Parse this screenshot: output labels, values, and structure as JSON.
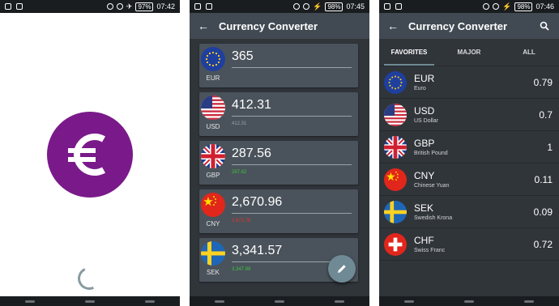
{
  "status": {
    "s1": {
      "battery": "97",
      "time": "07:42"
    },
    "s2": {
      "battery": "98",
      "time": "07:45"
    },
    "s3": {
      "battery": "98",
      "time": "07:46"
    }
  },
  "app": {
    "title": "Currency Converter",
    "back_icon": "back-arrow-icon",
    "search_icon": "search-icon"
  },
  "splash": {
    "logo_icon": "euro-icon",
    "logo_color": "#7a1a8a"
  },
  "converter": {
    "cards": [
      {
        "code": "EUR",
        "amount": "365",
        "sub": "",
        "sub_color": "#9aa2a8"
      },
      {
        "code": "USD",
        "amount": "412.31",
        "sub": "412.31",
        "sub_color": "#9aa2a8"
      },
      {
        "code": "GBP",
        "amount": "287.56",
        "sub": "287.62",
        "sub_color": "#3ec43e"
      },
      {
        "code": "CNY",
        "amount": "2,670.96",
        "sub": "2,672.79",
        "sub_color": "#e0352b"
      },
      {
        "code": "SEK",
        "amount": "3,341.57",
        "sub": "3,347.99",
        "sub_color": "#3ec43e"
      }
    ],
    "fab_icon": "pencil-icon"
  },
  "rates": {
    "tabs": [
      "FAVORITES",
      "MAJOR",
      "ALL"
    ],
    "active_tab": "FAVORITES",
    "rows": [
      {
        "code": "EUR",
        "name": "Euro",
        "rate": "0.79"
      },
      {
        "code": "USD",
        "name": "US Dollar",
        "rate": "0.7"
      },
      {
        "code": "GBP",
        "name": "British Pound",
        "rate": "1"
      },
      {
        "code": "CNY",
        "name": "Chinese Yuan",
        "rate": "0.11"
      },
      {
        "code": "SEK",
        "name": "Swedish Krona",
        "rate": "0.09"
      },
      {
        "code": "CHF",
        "name": "Swiss Franc",
        "rate": "0.72"
      }
    ]
  }
}
